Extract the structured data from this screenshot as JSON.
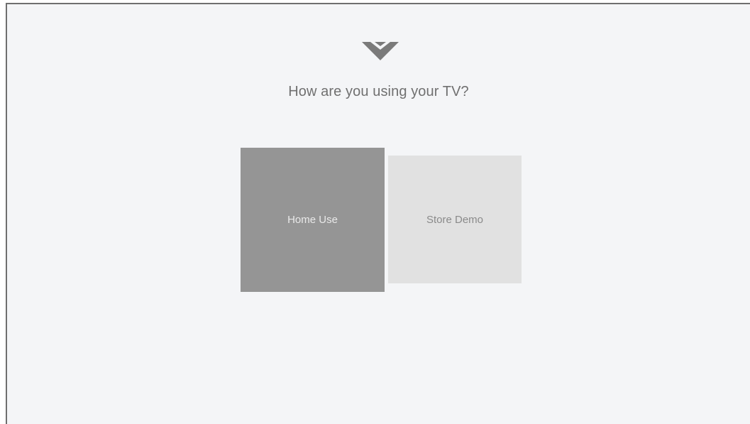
{
  "screen": {
    "title": "How are you using your TV?",
    "logo_icon": "vizio-v-logo-icon"
  },
  "options": [
    {
      "label": "Home Use",
      "selected": true,
      "color": "#959595"
    },
    {
      "label": "Store Demo",
      "selected": false,
      "color": "#e1e1e1"
    }
  ]
}
